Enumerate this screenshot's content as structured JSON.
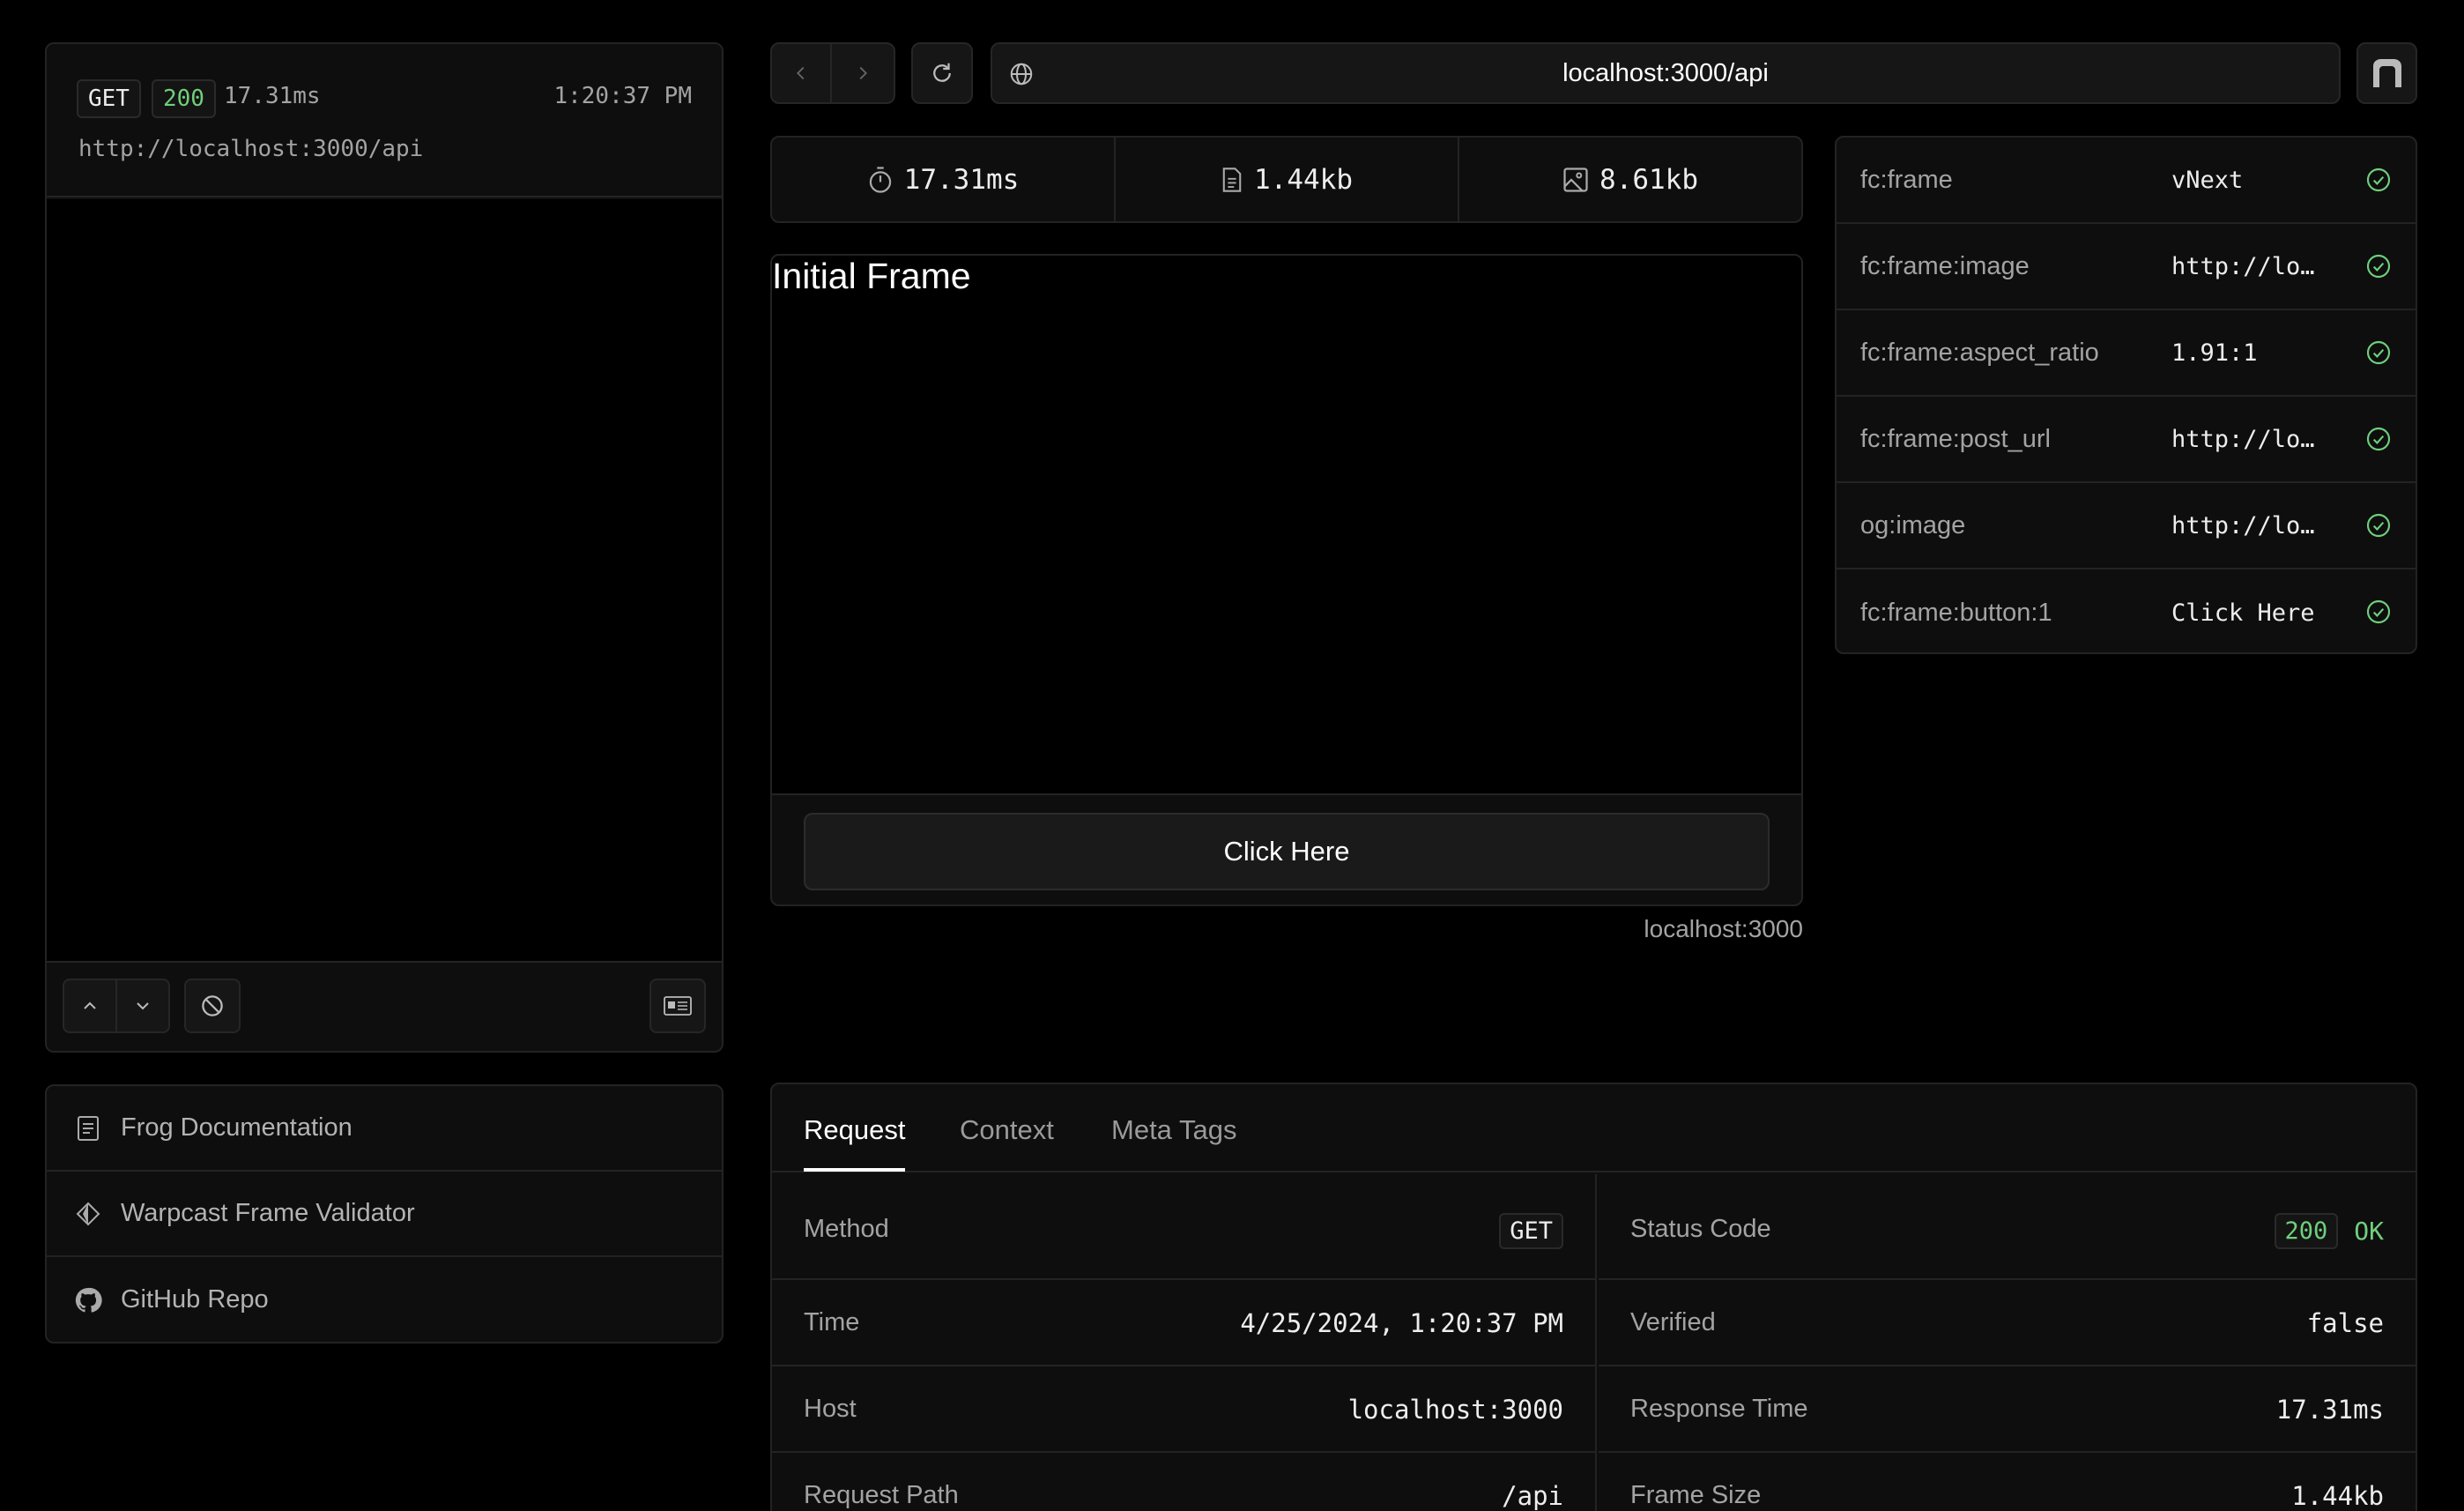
{
  "log": {
    "method": "GET",
    "status": "200",
    "duration": "17.31ms",
    "time": "1:20:37 PM",
    "url": "http://localhost:3000/api"
  },
  "links": [
    {
      "label": "Frog Documentation",
      "icon": "document-icon"
    },
    {
      "label": "Warpcast Frame Validator",
      "icon": "warpcast-icon"
    },
    {
      "label": "GitHub Repo",
      "icon": "github-icon"
    }
  ],
  "address_bar": {
    "url": "localhost:3000/api"
  },
  "stats": {
    "time": "17.31ms",
    "html_size": "1.44kb",
    "image_size": "8.61kb"
  },
  "frame": {
    "image_title": "Initial Frame",
    "button_label": "Click Here",
    "host": "localhost:3000"
  },
  "meta_tags": [
    {
      "key": "fc:frame",
      "value": "vNext"
    },
    {
      "key": "fc:frame:image",
      "value": "http://lo…"
    },
    {
      "key": "fc:frame:aspect_ratio",
      "value": "1.91:1"
    },
    {
      "key": "fc:frame:post_url",
      "value": "http://lo…"
    },
    {
      "key": "og:image",
      "value": "http://lo…"
    },
    {
      "key": "fc:frame:button:1",
      "value": "Click Here"
    }
  ],
  "tabs": [
    {
      "label": "Request"
    },
    {
      "label": "Context"
    },
    {
      "label": "Meta Tags"
    }
  ],
  "request": {
    "left": [
      {
        "label": "Method",
        "value": "GET"
      },
      {
        "label": "Time",
        "value": "4/25/2024, 1:20:37 PM"
      },
      {
        "label": "Host",
        "value": "localhost:3000"
      },
      {
        "label": "Request Path",
        "value": "/api"
      }
    ],
    "right": [
      {
        "label": "Status Code",
        "value": "200",
        "extra": "OK"
      },
      {
        "label": "Verified",
        "value": "false"
      },
      {
        "label": "Response Time",
        "value": "17.31ms"
      },
      {
        "label": "Frame Size",
        "value": "1.44kb"
      }
    ]
  },
  "colors": {
    "success": "#6fcf7c",
    "background": "#000000",
    "panel": "#0e0e0e",
    "border": "#232323"
  }
}
